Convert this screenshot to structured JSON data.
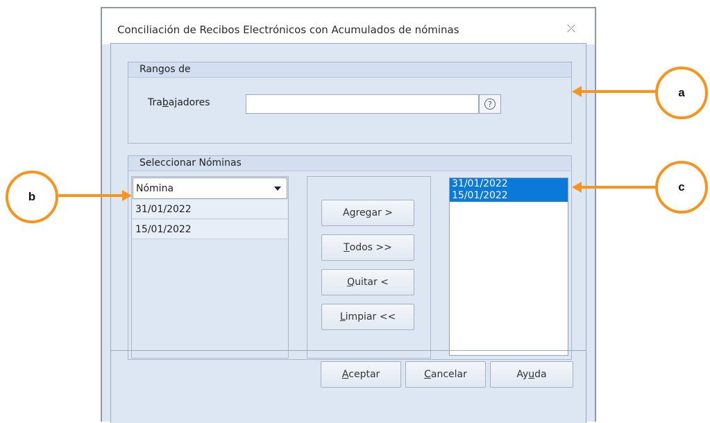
{
  "window": {
    "title": "Conciliación de Recibos Electrónicos con Acumulados de nóminas",
    "close_glyph": "⤫"
  },
  "rangos": {
    "group_title": "Rangos de",
    "trabajadores_label_pre": "Tra",
    "trabajadores_label_mnemonic": "b",
    "trabajadores_label_post": "ajadores",
    "trabajadores_value": "",
    "help_glyph": "?"
  },
  "nominas": {
    "group_title": "Seleccionar Nóminas",
    "available": {
      "column_header": "Nómina",
      "rows": [
        "31/01/2022",
        "15/01/2022"
      ]
    },
    "selected": [
      "31/01/2022",
      "15/01/2022"
    ],
    "buttons": {
      "agregar": {
        "pre": "A",
        "mn": "g",
        "post": "regar >"
      },
      "todos": {
        "pre": "",
        "mn": "T",
        "post": "odos >>"
      },
      "quitar": {
        "pre": "",
        "mn": "Q",
        "post": "uitar <"
      },
      "limpiar": {
        "pre": "",
        "mn": "L",
        "post": "impiar <<"
      }
    }
  },
  "footer": {
    "aceptar": {
      "pre": "",
      "mn": "A",
      "post": "ceptar"
    },
    "cancelar": {
      "pre": "",
      "mn": "C",
      "post": "ancelar"
    },
    "ayuda": {
      "pre": "Ay",
      "mn": "u",
      "post": "da"
    }
  },
  "callouts": {
    "a": "a",
    "b": "b",
    "c": "c"
  },
  "colors": {
    "accent": "#f7941d",
    "selection": "#0a7ad8",
    "window_bg": "#dde6f3"
  }
}
